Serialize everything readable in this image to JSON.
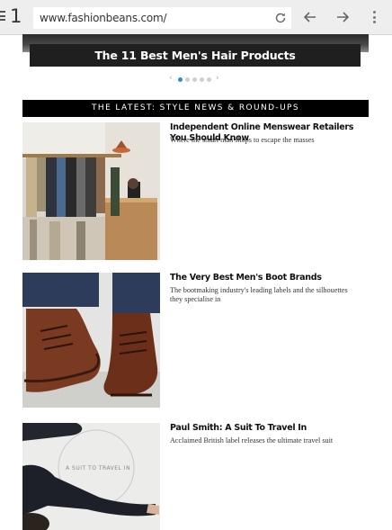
{
  "browser": {
    "tab_count": "1",
    "url": "www.fashionbeans.com/"
  },
  "hero": {
    "title": "The 11 Best Men's Hair Products",
    "slide_count": 6,
    "active_slide": 1
  },
  "section": {
    "title": "THE LATEST: STYLE NEWS & ROUND-UPS"
  },
  "articles": [
    {
      "title": "Independent Online Menswear Retailers You Should Know",
      "description": "Where the smart man shops to escape the masses"
    },
    {
      "title": "The Very Best Men's Boot Brands",
      "description": "The bootmaking industry's leading labels and the silhouettes they specialise in"
    },
    {
      "title": "Paul Smith: A Suit To Travel In",
      "description": "Acclaimed British label releases the ultimate travel suit",
      "image_text": "A SUIT TO TRAVEL IN"
    }
  ],
  "colors": {
    "accent": "#2a8fd0",
    "section_bar": "#000000",
    "toolbar": "#eeeeee"
  }
}
